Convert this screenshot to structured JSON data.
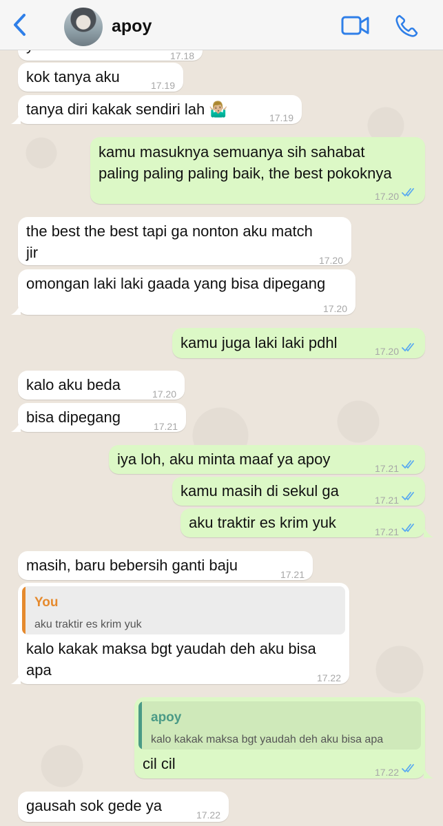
{
  "contact": {
    "name": "apoy"
  },
  "colors": {
    "incoming": "#ffffff",
    "outgoing": "#dcf8c6",
    "accent": "#2f7fe8",
    "read_ticks": "#5aa9f0",
    "quote_you": "#e58a2e",
    "quote_apoy": "#4a9a86"
  },
  "header": {
    "back_icon": "chevron-left-icon",
    "video_icon": "video-camera-icon",
    "call_icon": "phone-icon"
  },
  "messages": [
    {
      "dir": "in",
      "text": "ya mana aku tau",
      "time": "17.18"
    },
    {
      "dir": "in",
      "text": "kok tanya aku",
      "time": "17.19"
    },
    {
      "dir": "in",
      "text": "tanya diri kakak sendiri lah 🤷🏼‍♂️",
      "time": "17.19"
    },
    {
      "dir": "out",
      "text": "kamu masuknya semuanya sih sahabat",
      "text2": "paling paling paling baik, the best pokoknya",
      "time": "17.20",
      "status": "read"
    },
    {
      "dir": "in",
      "text": "the best the best tapi ga nonton aku match",
      "text2": "jir",
      "time": "17.20"
    },
    {
      "dir": "in",
      "text": "omongan laki laki gaada yang bisa dipegang",
      "time": "17.20"
    },
    {
      "dir": "out",
      "text": "kamu juga laki laki pdhl",
      "time": "17.20",
      "status": "read"
    },
    {
      "dir": "in",
      "text": "kalo aku beda",
      "time": "17.20"
    },
    {
      "dir": "in",
      "text": "bisa dipegang",
      "time": "17.21"
    },
    {
      "dir": "out",
      "text": "iya loh, aku minta maaf ya apoy",
      "time": "17.21",
      "status": "read"
    },
    {
      "dir": "out",
      "text": "kamu masih di sekul ga",
      "time": "17.21",
      "status": "read"
    },
    {
      "dir": "out",
      "text": "aku traktir es krim yuk",
      "time": "17.21",
      "status": "read"
    },
    {
      "dir": "in",
      "text": "masih, baru bebersih ganti baju",
      "time": "17.21"
    },
    {
      "dir": "in",
      "quote_name": "You",
      "quote_text": "aku traktir es krim yuk",
      "text": "kalo kakak maksa bgt yaudah deh aku bisa",
      "text2": "apa",
      "time": "17.22"
    },
    {
      "dir": "out",
      "quote_name": "apoy",
      "quote_text": "kalo kakak maksa bgt yaudah deh aku bisa apa",
      "text": "cil cil",
      "time": "17.22",
      "status": "read"
    },
    {
      "dir": "in",
      "text": "gausah sok gede ya",
      "time": "17.22"
    }
  ]
}
